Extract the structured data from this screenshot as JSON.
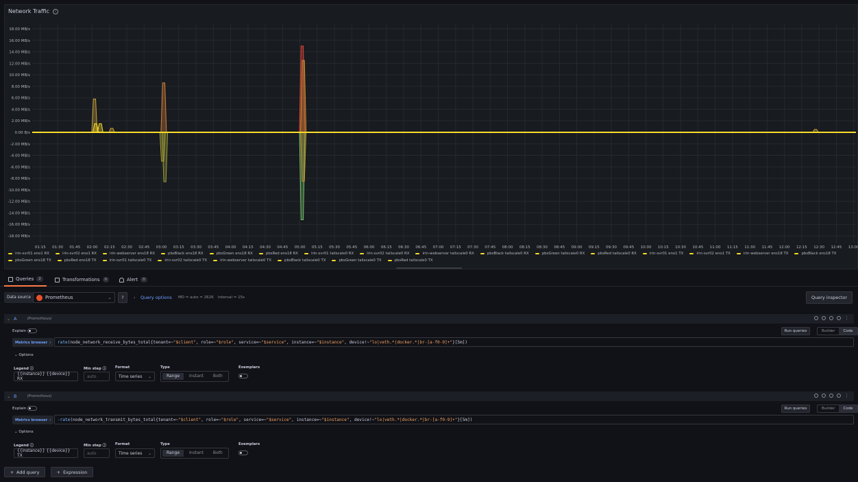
{
  "panel": {
    "title": "Network Traffic"
  },
  "chart_data": {
    "type": "line",
    "y_ticks": [
      "18.00 MB/s",
      "16.00 MB/s",
      "14.00 MB/s",
      "12.00 MB/s",
      "10.00 MB/s",
      "8.00 MB/s",
      "6.00 MB/s",
      "4.00 MB/s",
      "2.00 MB/s",
      "0.00 B/s",
      "-2.00 MB/s",
      "-4.00 MB/s",
      "-6.00 MB/s",
      "-8.00 MB/s",
      "-10.00 MB/s",
      "-12.00 MB/s",
      "-14.00 MB/s",
      "-16.00 MB/s",
      "-18.00 MB/s"
    ],
    "ylim": [
      -19,
      19
    ],
    "x_ticks": [
      "01:15",
      "01:30",
      "01:45",
      "02:00",
      "02:15",
      "02:30",
      "02:45",
      "03:00",
      "03:15",
      "03:30",
      "03:45",
      "04:00",
      "04:15",
      "04:30",
      "04:45",
      "05:00",
      "05:15",
      "05:30",
      "05:45",
      "06:00",
      "06:15",
      "06:30",
      "06:45",
      "07:00",
      "07:15",
      "07:30",
      "07:45",
      "08:00",
      "08:15",
      "08:30",
      "08:45",
      "09:00",
      "09:15",
      "09:30",
      "09:45",
      "10:00",
      "10:15",
      "10:30",
      "10:45",
      "11:00",
      "11:15",
      "11:30",
      "11:45",
      "12:00",
      "12:15",
      "12:30",
      "12:45",
      "13:00"
    ],
    "spikes": [
      {
        "time": "02:02",
        "value": 5.8,
        "color": "#c8a038"
      },
      {
        "time": "02:03",
        "value": 1.5,
        "color": "#fade2a"
      },
      {
        "time": "02:07",
        "value": 1.5,
        "color": "#fade2a"
      },
      {
        "time": "02:17",
        "value": 0.7,
        "color": "#c8a038"
      },
      {
        "time": "03:02",
        "value": 8.6,
        "color": "#d4803a"
      },
      {
        "time": "03:01",
        "value": -5.0,
        "color": "#a6a030"
      },
      {
        "time": "03:03",
        "value": -8.6,
        "color": "#9a9a3a"
      },
      {
        "time": "05:02",
        "value": 15.0,
        "color": "#e0463a"
      },
      {
        "time": "05:03",
        "value": 12.5,
        "color": "#c49030"
      },
      {
        "time": "05:02",
        "value": -15.2,
        "color": "#73bf69"
      },
      {
        "time": "05:03",
        "value": -8.5,
        "color": "#c49030"
      },
      {
        "time": "12:27",
        "value": 0.5,
        "color": "#c8a038"
      }
    ]
  },
  "legend": [
    {
      "label": "irin-svr01 eno1 RX",
      "color": "#fade2a"
    },
    {
      "label": "irin-svr02 eno1 RX",
      "color": "#fade2a"
    },
    {
      "label": "irin-webserver ens18 RX",
      "color": "#fade2a"
    },
    {
      "label": "pbsBlack ens18 RX",
      "color": "#fade2a"
    },
    {
      "label": "pbsGreen ens18 RX",
      "color": "#fade2a"
    },
    {
      "label": "pbsRed ens18 RX",
      "color": "#fade2a"
    },
    {
      "label": "irin-svr01 tailscale0 RX",
      "color": "#fade2a"
    },
    {
      "label": "irin-svr02 tailscale0 RX",
      "color": "#fade2a"
    },
    {
      "label": "irin-webserver tailscale0 RX",
      "color": "#fade2a"
    },
    {
      "label": "pbsBlack tailscale0 RX",
      "color": "#fade2a"
    },
    {
      "label": "pbsGreen tailscale0 RX",
      "color": "#fade2a"
    },
    {
      "label": "pbsRed tailscale0 RX",
      "color": "#fade2a"
    },
    {
      "label": "irin-svr01 eno1 TX",
      "color": "#fade2a"
    },
    {
      "label": "irin-svr02 eno1 TX",
      "color": "#fade2a"
    },
    {
      "label": "irin-webserver ens18 TX",
      "color": "#fade2a"
    },
    {
      "label": "pbsBlack ens18 TX",
      "color": "#fade2a"
    },
    {
      "label": "pbsGreen ens18 TX",
      "color": "#fade2a"
    },
    {
      "label": "pbsRed ens18 TX",
      "color": "#fade2a"
    },
    {
      "label": "irin-svr01 tailscale0 TX",
      "color": "#fade2a"
    },
    {
      "label": "irin-svr02 tailscale0 TX",
      "color": "#fade2a"
    },
    {
      "label": "irin-webserver tailscale0 TX",
      "color": "#fade2a"
    },
    {
      "label": "pbsBlack tailscale0 TX",
      "color": "#fade2a"
    },
    {
      "label": "pbsGreen tailscale0 TX",
      "color": "#fade2a"
    },
    {
      "label": "pbsRed tailscale0 TX",
      "color": "#fade2a"
    }
  ],
  "tabs": {
    "queries": {
      "label": "Queries",
      "count": "2"
    },
    "transformations": {
      "label": "Transformations",
      "count": "0"
    },
    "alert": {
      "label": "Alert",
      "count": "0"
    }
  },
  "toolbar": {
    "datasource_label": "Data source",
    "datasource_value": "Prometheus",
    "query_options": "Query options",
    "md": "MD = auto = 2626",
    "interval": "Interval = 15s",
    "inspector": "Query inspector"
  },
  "queries": [
    {
      "letter": "A",
      "ds": "(Prometheus)",
      "explain": "Explain",
      "run": "Run queries",
      "builder": "Builder",
      "code": "Code",
      "metrics_browser": "Metrics browser",
      "expr_fn": "rate",
      "expr_a": "(node_network_receive_bytes_total{tenant=~",
      "expr_s1": "\"$client\"",
      "expr_b": ", role=~",
      "expr_s2": "\"$role\"",
      "expr_c": ", service=~",
      "expr_s3": "\"$service\"",
      "expr_d": ", instance=~",
      "expr_s4": "\"$instance\"",
      "expr_e": ", device!~",
      "expr_s5": "\"lo|veth.*|docker.*|br-[a-f0-9]+\"",
      "expr_f": "}[5m])",
      "options": "Options",
      "legend_label": "Legend",
      "legend_value": "{{instance}} {{device}} RX",
      "minstep_label": "Min step",
      "minstep_placeholder": "auto",
      "format_label": "Format",
      "format_value": "Time series",
      "type_label": "Type",
      "type_range": "Range",
      "type_instant": "Instant",
      "type_both": "Both",
      "exemplars_label": "Exemplars"
    },
    {
      "letter": "B",
      "ds": "(Prometheus)",
      "explain": "Explain",
      "run": "Run queries",
      "builder": "Builder",
      "code": "Code",
      "metrics_browser": "Metrics browser",
      "expr_fn": "-rate",
      "expr_a": "(node_network_transmit_bytes_total{tenant=~",
      "expr_s1": "\"$client\"",
      "expr_b": ", role=~",
      "expr_s2": "\"$role\"",
      "expr_c": ", service=~",
      "expr_s3": "\"$service\"",
      "expr_d": ", instance=~",
      "expr_s4": "\"$instance\"",
      "expr_e": ", device!~",
      "expr_s5": "\"lo|veth.*|docker.*|br-[a-f0-9]+\"",
      "expr_f": "}[5m])",
      "options": "Options",
      "legend_label": "Legend",
      "legend_value": "{{instance}} {{device}} TX",
      "minstep_label": "Min step",
      "minstep_placeholder": "auto",
      "format_label": "Format",
      "format_value": "Time series",
      "type_label": "Type",
      "type_range": "Range",
      "type_instant": "Instant",
      "type_both": "Both",
      "exemplars_label": "Exemplars"
    }
  ],
  "footer": {
    "add_query": "Add query",
    "expression": "Expression"
  }
}
